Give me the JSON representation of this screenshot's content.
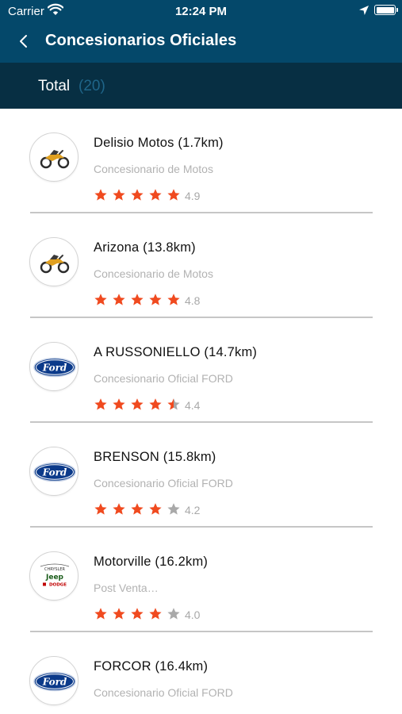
{
  "status_bar": {
    "carrier": "Carrier",
    "time": "12:24 PM"
  },
  "nav": {
    "title": "Concesionarios Oficiales"
  },
  "summary": {
    "total_label": "Total",
    "total_count": "(20)"
  },
  "colors": {
    "header_bg": "#04486a",
    "summary_bg": "#072f43",
    "total_count": "#1f6589",
    "star_active": "#f04a1f",
    "star_inactive": "#a9a9a9"
  },
  "dealers": [
    {
      "name": "Delisio Motos (1.7km)",
      "category": "Concesionario de Motos",
      "rating": "4.9",
      "stars": 5,
      "logo": "motorcycle-logo"
    },
    {
      "name": "Arizona (13.8km)",
      "category": "Concesionario de Motos",
      "rating": "4.8",
      "stars": 5,
      "logo": "motorcycle-logo"
    },
    {
      "name": "A RUSSONIELLO  (14.7km)",
      "category": "Concesionario Oficial FORD",
      "rating": "4.4",
      "stars": 4.5,
      "logo": "ford-logo"
    },
    {
      "name": "BRENSON  (15.8km)",
      "category": "Concesionario Oficial FORD",
      "rating": "4.2",
      "stars": 4,
      "logo": "ford-logo"
    },
    {
      "name": "Motorville (16.2km)",
      "category": "Post Venta…",
      "rating": "4.0",
      "stars": 4,
      "logo": "chrysler-jeep-dodge-logo",
      "logo_text": [
        "CHRYSLER",
        "Jeep",
        "DODGE"
      ]
    },
    {
      "name": "FORCOR (16.4km)",
      "category": "Concesionario Oficial FORD",
      "rating": "",
      "stars": 0,
      "logo": "ford-logo"
    }
  ]
}
